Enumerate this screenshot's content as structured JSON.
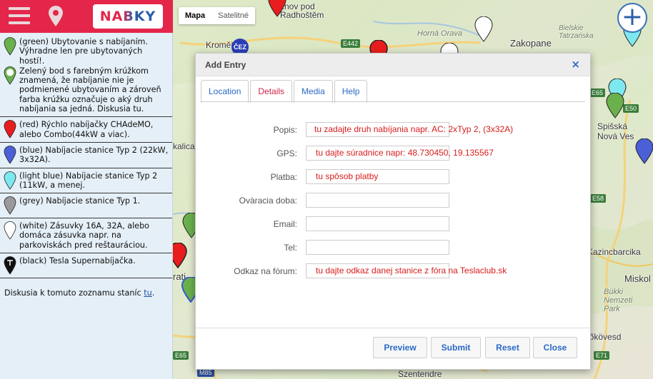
{
  "topbar": {
    "logo_text": "NABKY"
  },
  "map": {
    "type_buttons": [
      "Mapa",
      "Satelitné"
    ],
    "labels": {
      "roznov": "žnov pod\nRadhoštěm",
      "kromeriz": "Kroměříž",
      "horna_orava": "Horná Orava",
      "bielsko": "Bielskie\nTatrzańska",
      "zakopane": "Zakopane",
      "spisska": "Spišská\nNová Ves",
      "kazincbarcika": "Kazincbarcika",
      "miskolc": "Miskol",
      "bukki": "Bükki\nNemzeti\nPark",
      "mezokovesd": "Mezőkövesd",
      "szentendre": "Szentendre",
      "calica": "kalica",
      "rati": "rati"
    },
    "roads": [
      "E442",
      "E50",
      "E58",
      "E71",
      "E65",
      "M85",
      "E65"
    ],
    "cez": "ČEZ",
    "add_button": "+"
  },
  "legend": [
    {
      "color": "green",
      "text": "(green) Ubytovanie s nabíjaním. Výhradne len pre ubytovaných hostí!."
    },
    {
      "color": "green-ring",
      "text": "Zelený bod s farebným krúžkom znamená, že nabíjanie nie je podmienené ubytovaním a zároveň farba krúžku označuje o aký druh nabíjania sa jedná. Diskusia tu."
    },
    {
      "color": "red",
      "text": "(red) Rýchlo nabíjačky CHAdeMO, alebo Combo(44kW a viac)."
    },
    {
      "color": "blue",
      "text": "(blue) Nabíjacie stanice Typ 2 (22kW, 3x32A)."
    },
    {
      "color": "lightblue",
      "text": "(light blue) Nabíjacie stanice Typ 2 (11kW, a menej."
    },
    {
      "color": "grey",
      "text": "(grey) Nabíjacie stanice Typ 1."
    },
    {
      "color": "white",
      "text": "(white) Zásuvky 16A, 32A, alebo domáca zásuvka napr. na parkoviskách pred reštauráciou."
    },
    {
      "color": "black",
      "text": "(black) Tesla Supernabíjačka."
    }
  ],
  "footer": {
    "prefix": "Diskusia k tomuto zoznamu staníc ",
    "link": "tu",
    "suffix": "."
  },
  "dialog": {
    "title": "Add Entry",
    "close": "×",
    "tabs": [
      "Location",
      "Details",
      "Media",
      "Help"
    ],
    "active_tab": "Details",
    "fields": [
      {
        "label": "Popis:",
        "value": "",
        "hint": "tu zadajte druh nabíjania napr. AC: 2xTyp 2, (3x32A)"
      },
      {
        "label": "GPS:",
        "value": "",
        "hint": "tu dajte súradnice napr:  48.730450, 19.135567"
      },
      {
        "label": "Platba:",
        "value": "",
        "hint": "tu spôsob platby"
      },
      {
        "label": "Ovàracia doba:",
        "value": "",
        "hint": ""
      },
      {
        "label": "Email:",
        "value": "",
        "hint": ""
      },
      {
        "label": "Tel:",
        "value": "",
        "hint": ""
      },
      {
        "label": "Odkaz na fórum:",
        "value": "",
        "hint": "tu dajte odkaz danej stanice z fóra na Teslaclub.sk"
      }
    ],
    "buttons": [
      "Preview",
      "Submit",
      "Reset",
      "Close"
    ]
  },
  "colors": {
    "topbar": "#e4264a",
    "sidebar_bg": "#e5eff7",
    "link_blue": "#2a6ac5",
    "hint_red": "#d81c1c",
    "active_tab": "#d0234a",
    "pin_green": "#6ab04c",
    "pin_red": "#e81d1d",
    "pin_blue": "#4b5fd6",
    "pin_lightblue": "#7ee8f0",
    "pin_grey": "#9a9a9a",
    "pin_white": "#ffffff",
    "pin_black": "#111111"
  }
}
